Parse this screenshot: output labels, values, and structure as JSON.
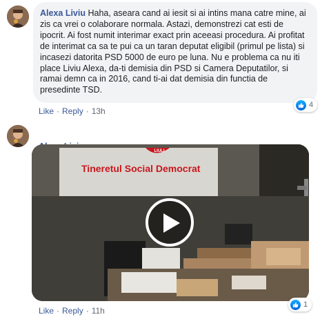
{
  "comment1": {
    "author": "Alexa Liviu",
    "text": "Haha, aseara cand ai iesit si ai intins mana catre mine, ai zis ca vrei o colaborare normala. Astazi, demonstrezi cat esti de ipocrit. Ai fost numit interimar exact prin aceeasi procedura. Ai profitat de interimat ca sa te pui ca un taran deputat eligibil (primul pe lista) si incasezi datorita PSD 5000 de euro pe luna. Nu e problema ca nu iti place Liviu Alexa, da-ti demisia din PSD si Camera Deputatilor, si ramai demn ca in 2016, cand ti-ai dat demisia din functia de presedinte TSD.",
    "like_label": "Like",
    "reply_label": "Reply",
    "time": "13h",
    "reaction_count": "4"
  },
  "comment2": {
    "author": "Alexa Liviu",
    "banner_title": "Tineretul Social Democrat",
    "banner_logo_text": "LIULI",
    "like_label": "Like",
    "reply_label": "Reply",
    "time": "11h",
    "reaction_count": "1"
  },
  "icons": {
    "like_reaction": "thumbs-up-icon",
    "play": "play-icon"
  },
  "colors": {
    "link": "#385898",
    "bubble": "#f2f3f5",
    "meta": "#606770",
    "banner_red": "#c8161d"
  }
}
